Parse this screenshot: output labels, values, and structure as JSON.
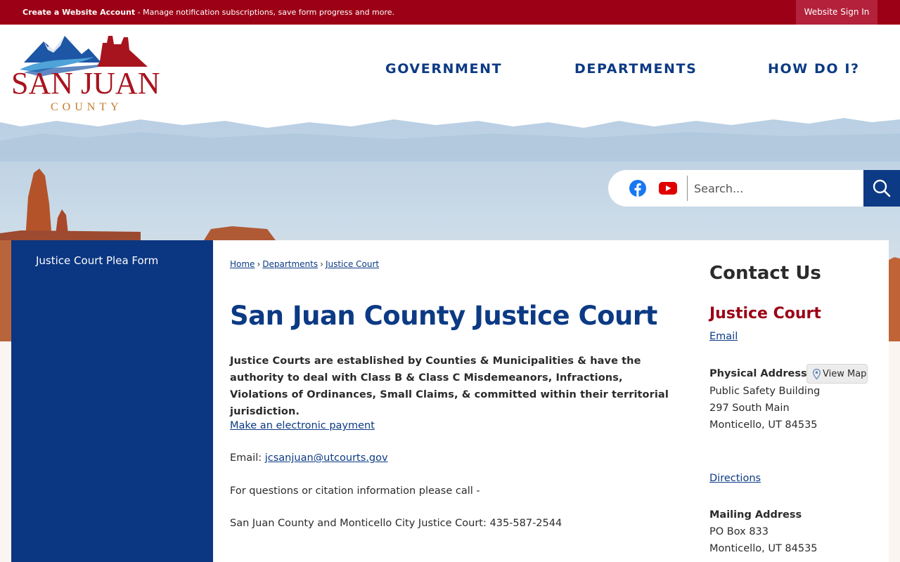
{
  "topbar": {
    "account_link": "Create a Website Account",
    "account_desc": " - Manage notification subscriptions, save form progress and more.",
    "signin": "Website Sign In"
  },
  "logo": {
    "name": "SAN JUAN",
    "subtitle": "COUNTY"
  },
  "nav": {
    "items": [
      "GOVERNMENT",
      "DEPARTMENTS",
      "HOW DO I?"
    ]
  },
  "search": {
    "placeholder": "Search..."
  },
  "social": {
    "icons": [
      "facebook-icon",
      "youtube-icon"
    ]
  },
  "sidebar": {
    "items": [
      "Justice Court Plea Form"
    ]
  },
  "breadcrumb": {
    "items": [
      "Home",
      "Departments",
      "Justice Court"
    ],
    "separator": "›"
  },
  "page": {
    "title": "San Juan County Justice Court",
    "intro": "Justice Courts are established by Counties & Municipalities & have the authority to deal with Class B & Class C Misdemeanors, Infractions, Violations of Ordinances, Small Claims, & committed within their territorial jurisdiction.",
    "payment_link": "Make an electronic payment",
    "email_label": "Email: ",
    "email_value": "jcsanjuan@utcourts.gov",
    "questions": "For questions or citation information please call -",
    "phone_line": "San Juan County and Monticello City Justice Court: 435-587-2544"
  },
  "contact": {
    "title": "Contact Us",
    "dept": "Justice Court",
    "email_link": "Email",
    "physical_label": "Physical Address",
    "view_map": "View Map",
    "physical_lines": [
      "Public Safety Building",
      "297 South Main",
      "Monticello, UT 84535"
    ],
    "directions": "Directions",
    "mailing_label": "Mailing Address",
    "mailing_lines": [
      "PO Box 833",
      "Monticello, UT 84535"
    ]
  },
  "colors": {
    "brand_red": "#9b0016",
    "brand_blue": "#0c3a84",
    "sidebar_blue": "#0b3681"
  }
}
